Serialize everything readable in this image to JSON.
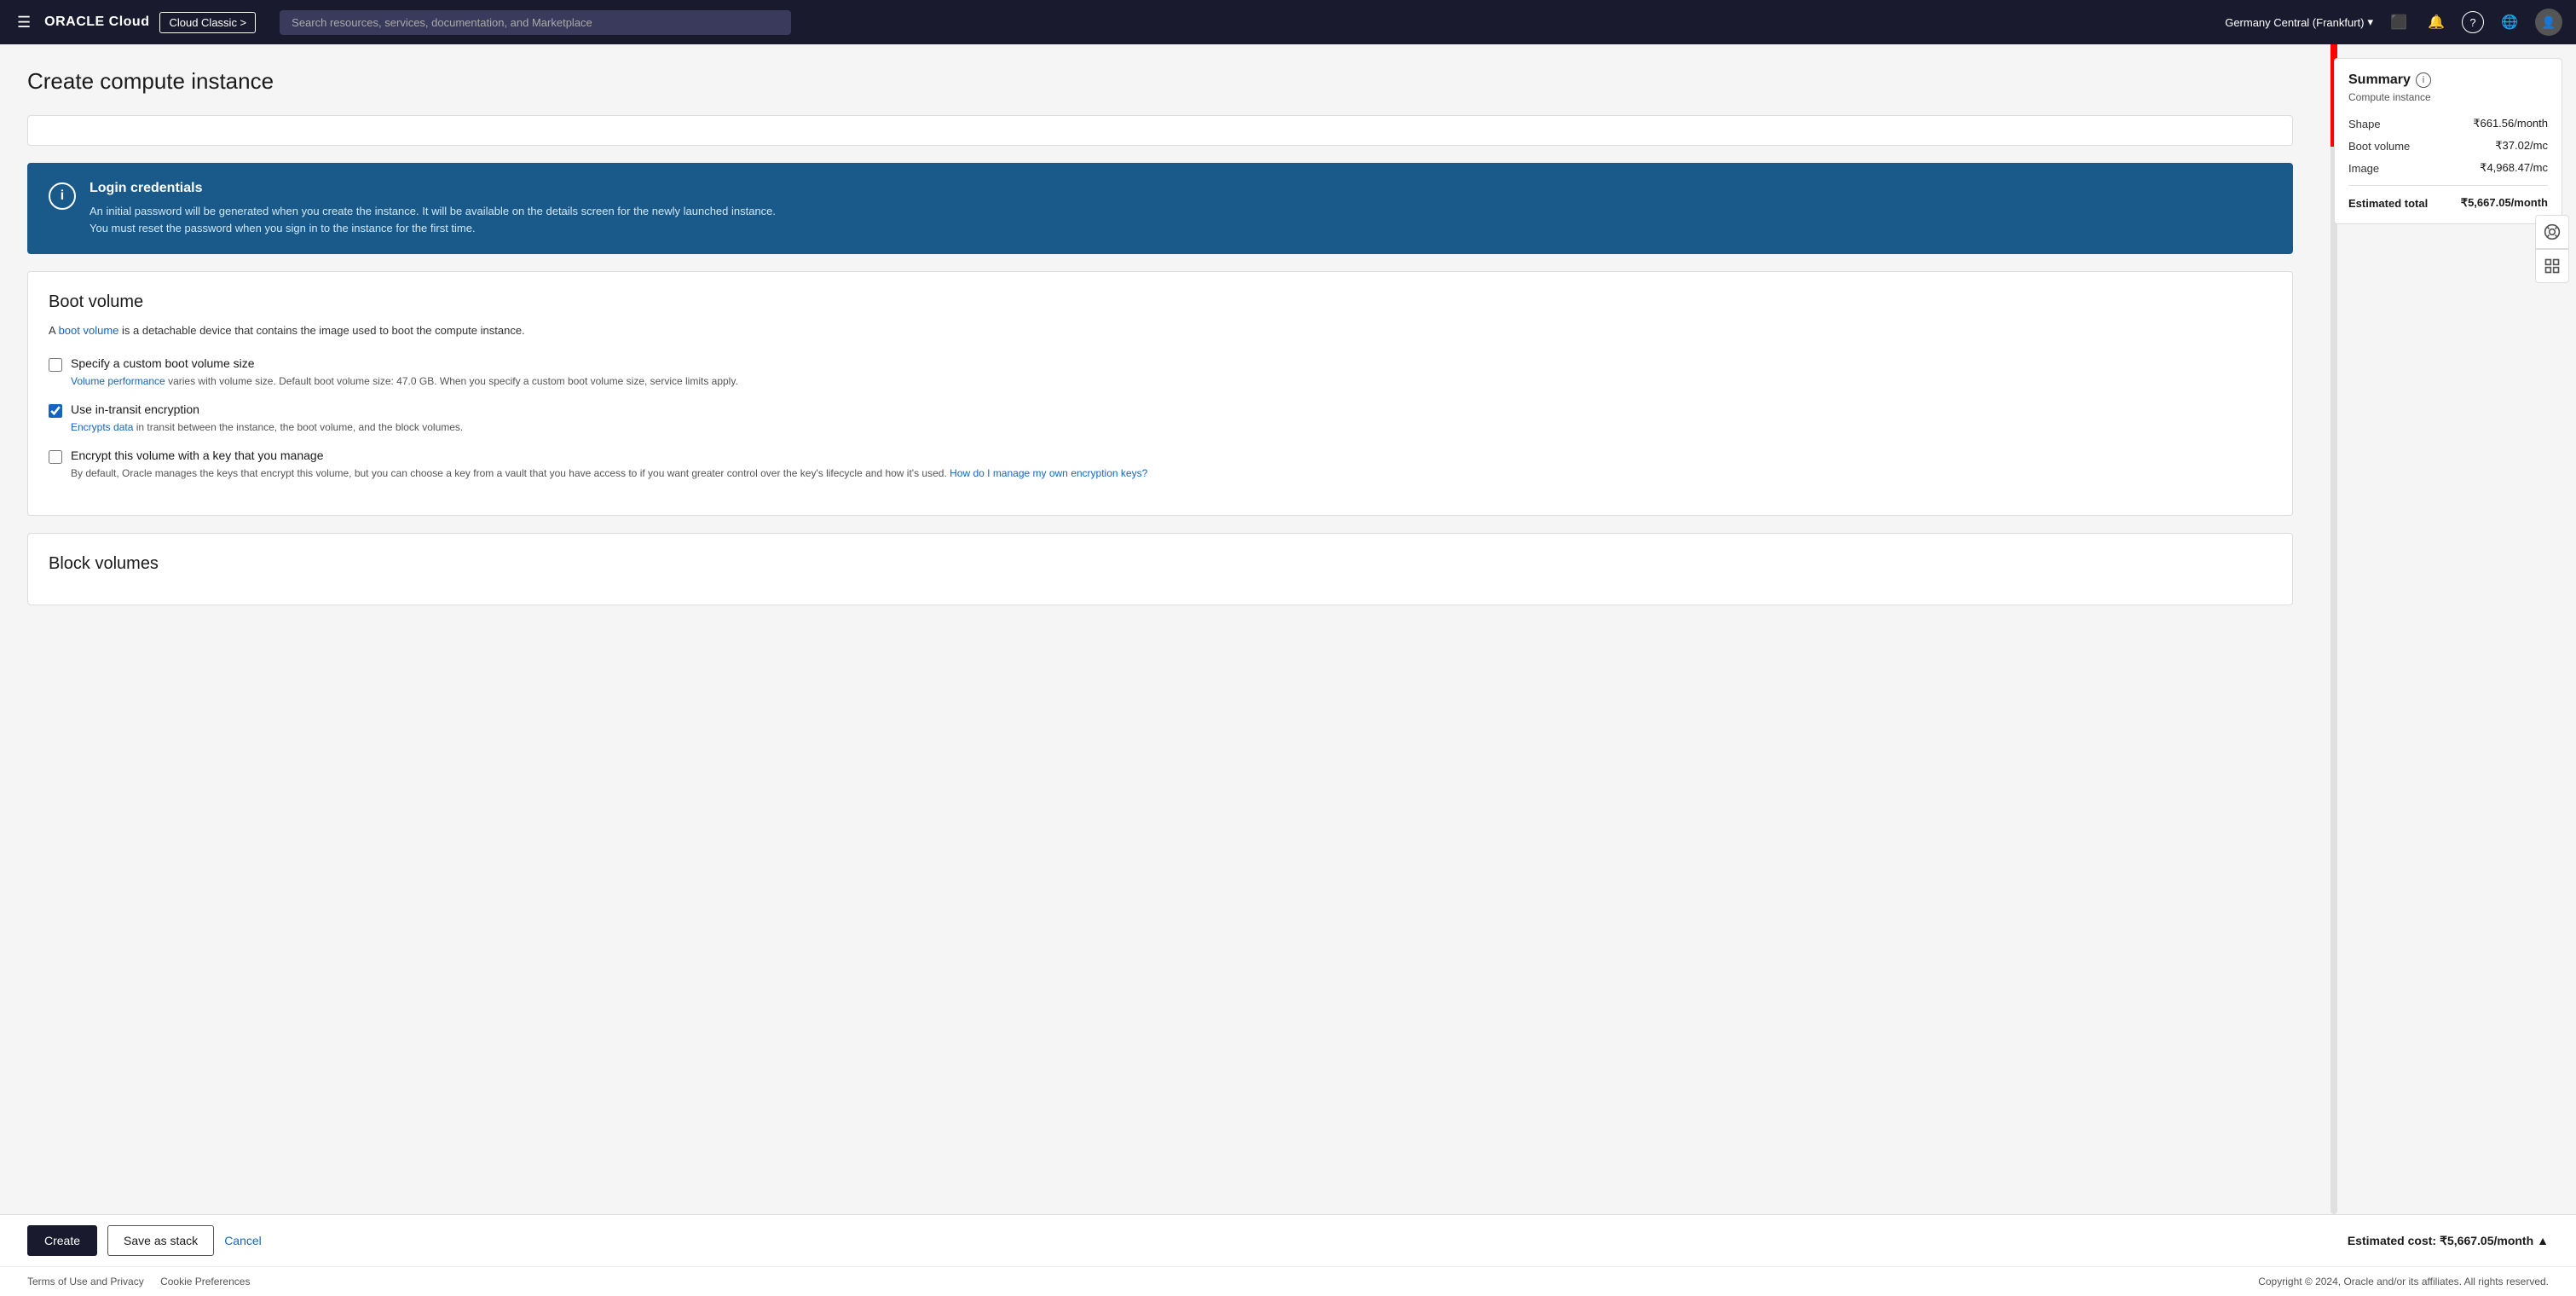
{
  "nav": {
    "hamburger_label": "☰",
    "logo_text": "ORACLE",
    "logo_suffix": " Cloud",
    "cloud_classic_btn": "Cloud Classic >",
    "search_placeholder": "Search resources, services, documentation, and Marketplace",
    "region": "Germany Central (Frankfurt)",
    "region_chevron": "▾",
    "icons": {
      "terminal": "⬜",
      "bell": "🔔",
      "help": "?",
      "globe": "🌐",
      "avatar": "👤"
    }
  },
  "page": {
    "title": "Create compute instance"
  },
  "login_credentials": {
    "title": "Login credentials",
    "info_icon": "i",
    "description_line1": "An initial password will be generated when you create the instance. It will be available on the details screen for the newly launched instance.",
    "description_line2": "You must reset the password when you sign in to the instance for the first time."
  },
  "boot_volume": {
    "section_title": "Boot volume",
    "description_text": "A ",
    "description_link": "boot volume",
    "description_rest": " is a detachable device that contains the image used to boot the compute instance.",
    "custom_size_label": "Specify a custom boot volume size",
    "custom_size_sublabel": "Volume performance",
    "custom_size_sublabel_rest": " varies with volume size. Default boot volume size: 47.0 GB. When you specify a custom boot volume size, service limits apply.",
    "custom_size_sublabel_link": "Volume performance",
    "custom_size_checked": false,
    "encrypt_transit_label": "Use in-transit encryption",
    "encrypt_transit_sublabel_link": "Encrypts data",
    "encrypt_transit_sublabel_rest": " in transit between the instance, the boot volume, and the block volumes.",
    "encrypt_transit_checked": true,
    "encrypt_key_label": "Encrypt this volume with a key that you manage",
    "encrypt_key_sublabel": "By default, Oracle manages the keys that encrypt this volume, but you can choose a key from a vault that you have access to if you want greater control over the key's lifecycle and how it's used.",
    "encrypt_key_link": "How do I manage my own encryption keys?",
    "encrypt_key_checked": false
  },
  "block_volumes": {
    "section_title": "Block volumes"
  },
  "summary": {
    "title": "Summary",
    "info_icon": "i",
    "subtitle": "Compute instance",
    "shape_label": "Shape",
    "shape_value": "₹661.56/month",
    "boot_volume_label": "Boot volume",
    "boot_volume_value": "₹37.02/mc",
    "image_label": "Image",
    "image_value": "₹4,968.47/mc",
    "estimated_total_label": "Estimated total",
    "estimated_total_value": "₹5,667.05/month"
  },
  "bottom_bar": {
    "create_btn": "Create",
    "save_stack_btn": "Save as stack",
    "cancel_btn": "Cancel",
    "estimated_cost_label": "Estimated cost:",
    "estimated_cost_value": "₹5,667.05/month",
    "cost_chevron": "▲"
  },
  "footer": {
    "terms_link": "Terms of Use and Privacy",
    "cookie_link": "Cookie Preferences",
    "copyright": "Copyright © 2024, Oracle and/or its affiliates. All rights reserved."
  }
}
